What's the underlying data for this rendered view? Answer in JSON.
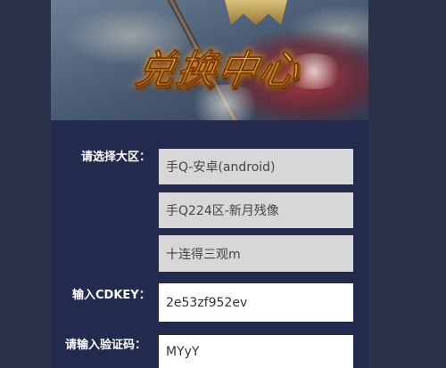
{
  "banner": {
    "title": "兑换中心"
  },
  "form": {
    "region_label": "请选择大区：",
    "platform_value": "手Q-安卓(android)",
    "server_value": "手Q224区-新月残像",
    "role_value": "十连得三观m",
    "cdkey_label": "输入CDKEY：",
    "cdkey_value": "2e53zf952ev",
    "captcha_label": "请输入验证码：",
    "captcha_value": "MYyY"
  }
}
